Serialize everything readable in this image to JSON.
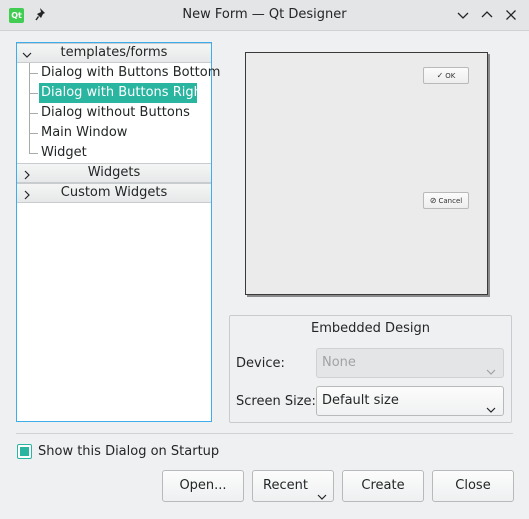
{
  "window": {
    "title": "New Form — Qt Designer",
    "app_icon_text": "Qt"
  },
  "tree": {
    "categories": [
      {
        "label": "templates/forms",
        "expanded": true
      },
      {
        "label": "Widgets",
        "expanded": false
      },
      {
        "label": "Custom Widgets",
        "expanded": false
      }
    ],
    "items": [
      {
        "label": "Dialog with Buttons Bottom"
      },
      {
        "label": "Dialog with Buttons Right",
        "selected": true
      },
      {
        "label": "Dialog without Buttons"
      },
      {
        "label": "Main Window"
      },
      {
        "label": "Widget"
      }
    ]
  },
  "preview": {
    "ok_label": "OK",
    "cancel_label": "Cancel"
  },
  "embedded": {
    "title": "Embedded Design",
    "device_label": "Device:",
    "device_value": "None",
    "screen_label": "Screen Size:",
    "screen_value": "Default size"
  },
  "startup": {
    "label": "Show this Dialog on Startup",
    "checked": true
  },
  "buttons": {
    "open": "Open...",
    "recent": "Recent",
    "create": "Create",
    "close": "Close"
  },
  "colors": {
    "selection": "#2ab5a0",
    "focus_border": "#3daee9",
    "window_bg": "#eff0f1"
  }
}
